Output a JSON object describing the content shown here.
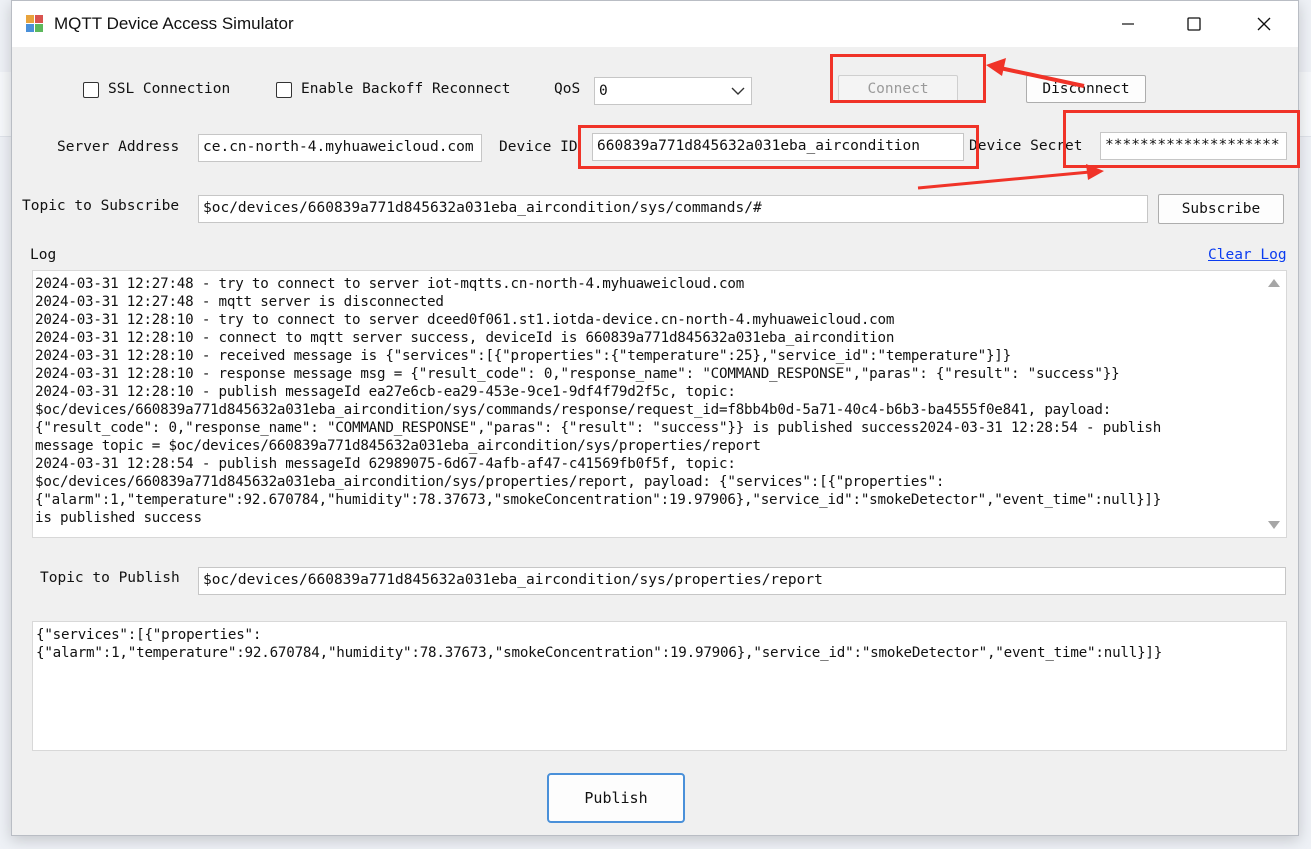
{
  "window": {
    "title": "MQTT Device Access Simulator"
  },
  "options": {
    "ssl_label": "SSL Connection",
    "ssl_checked": false,
    "backoff_label": "Enable Backoff Reconnect",
    "backoff_checked": false,
    "qos_label": "QoS",
    "qos_value": "0"
  },
  "actions": {
    "connect_label": "Connect",
    "disconnect_label": "Disconnect",
    "subscribe_label": "Subscribe",
    "publish_label": "Publish",
    "clear_log_label": "Clear Log"
  },
  "server": {
    "address_label": "Server Address",
    "address_value": "ce.cn-north-4.myhuaweicloud.com",
    "device_id_label": "Device ID",
    "device_id_value": "660839a771d845632a031eba_aircondition",
    "device_secret_label": "Device Secret",
    "device_secret_value": "********************"
  },
  "subscribe": {
    "label": "Topic to Subscribe",
    "value": "$oc/devices/660839a771d845632a031eba_aircondition/sys/commands/#"
  },
  "log": {
    "label": "Log",
    "text": "2024-03-31 12:27:48 - try to connect to server iot-mqtts.cn-north-4.myhuaweicloud.com\n2024-03-31 12:27:48 - mqtt server is disconnected\n2024-03-31 12:28:10 - try to connect to server dceed0f061.st1.iotda-device.cn-north-4.myhuaweicloud.com\n2024-03-31 12:28:10 - connect to mqtt server success, deviceId is 660839a771d845632a031eba_aircondition\n2024-03-31 12:28:10 - received message is {\"services\":[{\"properties\":{\"temperature\":25},\"service_id\":\"temperature\"}]}\n2024-03-31 12:28:10 - response message msg = {\"result_code\": 0,\"response_name\": \"COMMAND_RESPONSE\",\"paras\": {\"result\": \"success\"}}\n2024-03-31 12:28:10 - publish messageId ea27e6cb-ea29-453e-9ce1-9df4f79d2f5c, topic:\n$oc/devices/660839a771d845632a031eba_aircondition/sys/commands/response/request_id=f8bb4b0d-5a71-40c4-b6b3-ba4555f0e841, payload:\n{\"result_code\": 0,\"response_name\": \"COMMAND_RESPONSE\",\"paras\": {\"result\": \"success\"}} is published success2024-03-31 12:28:54 - publish\nmessage topic = $oc/devices/660839a771d845632a031eba_aircondition/sys/properties/report\n2024-03-31 12:28:54 - publish messageId 62989075-6d67-4afb-af47-c41569fb0f5f, topic:\n$oc/devices/660839a771d845632a031eba_aircondition/sys/properties/report, payload: {\"services\":[{\"properties\":\n{\"alarm\":1,\"temperature\":92.670784,\"humidity\":78.37673,\"smokeConcentration\":19.97906},\"service_id\":\"smokeDetector\",\"event_time\":null}]}\nis published success"
  },
  "publish": {
    "topic_label": "Topic to Publish",
    "topic_value": "$oc/devices/660839a771d845632a031eba_aircondition/sys/properties/report",
    "payload": "{\"services\":[{\"properties\":\n{\"alarm\":1,\"temperature\":92.670784,\"humidity\":78.37673,\"smokeConcentration\":19.97906},\"service_id\":\"smokeDetector\",\"event_time\":null}]}"
  },
  "colors": {
    "highlight": "#f03328",
    "link": "#0a3cf0",
    "publish_border": "#4a90d9"
  },
  "icons": {
    "app": "app-window-icon",
    "minimize": "minimize-icon",
    "maximize": "maximize-icon",
    "close": "close-icon"
  }
}
